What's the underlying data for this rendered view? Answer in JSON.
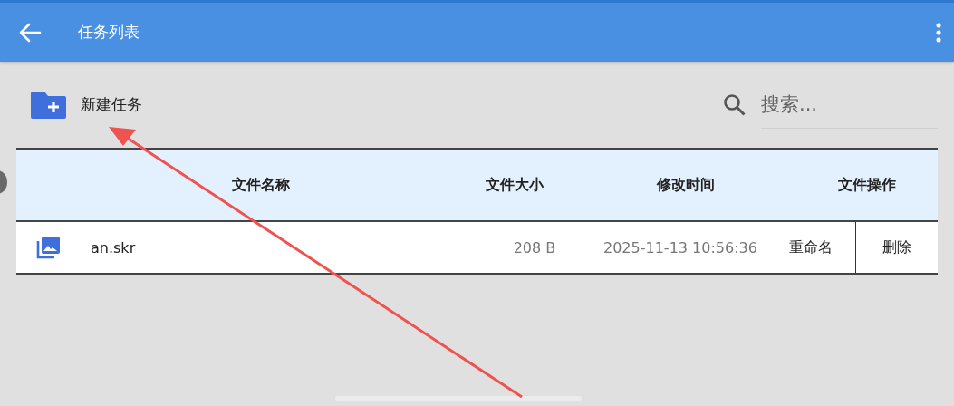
{
  "app_bar": {
    "title": "任务列表"
  },
  "toolbar": {
    "new_task": "新建任务",
    "search": {
      "placeholder": "搜索..."
    }
  },
  "table": {
    "columns": [
      "文件名称",
      "文件大小",
      "修改时间",
      "文件操作"
    ],
    "rows": [
      {
        "name": "an.skr",
        "size": "208 B",
        "modified": "2025-11-13 10:56:36",
        "actions": [
          "重命名",
          "删除"
        ]
      }
    ]
  }
}
